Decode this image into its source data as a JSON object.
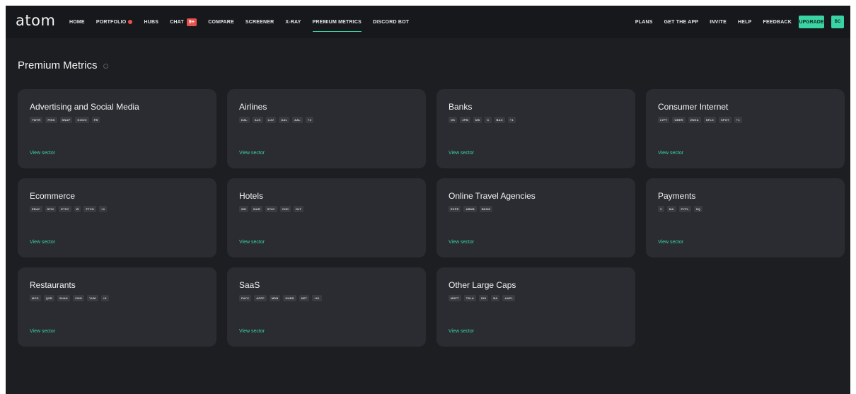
{
  "logo": "atom",
  "nav": {
    "left": [
      {
        "label": "HOME"
      },
      {
        "label": "PORTFOLIO",
        "dot": true
      },
      {
        "label": "HUBS"
      },
      {
        "label": "CHAT",
        "badge": "9+"
      },
      {
        "label": "COMPARE"
      },
      {
        "label": "SCREENER"
      },
      {
        "label": "X-RAY"
      },
      {
        "label": "PREMIUM METRICS",
        "active": true
      },
      {
        "label": "DISCORD BOT"
      }
    ],
    "right": [
      {
        "label": "PLANS"
      },
      {
        "label": "GET THE APP"
      },
      {
        "label": "INVITE"
      },
      {
        "label": "HELP"
      },
      {
        "label": "FEEDBACK"
      }
    ],
    "upgrade": "UPGRADE",
    "avatar": "BC"
  },
  "page_title": "Premium Metrics",
  "view_label": "View sector",
  "sectors": [
    {
      "name": "Advertising and Social Media",
      "tickers": [
        "TWTR",
        "PINS",
        "SNAP",
        "GOOG",
        "FB"
      ]
    },
    {
      "name": "Airlines",
      "tickers": [
        "DAL",
        "ALK",
        "LUV",
        "UAL",
        "AAL",
        "+3"
      ]
    },
    {
      "name": "Banks",
      "tickers": [
        "GS",
        "JPM",
        "MS",
        "C",
        "BAC",
        "+1"
      ]
    },
    {
      "name": "Consumer Internet",
      "tickers": [
        "LYFT",
        "UBER",
        "ZNGA",
        "NFLX",
        "SPOT",
        "+1"
      ]
    },
    {
      "name": "Ecommerce",
      "tickers": [
        "EBAY",
        "SFIX",
        "ETSY",
        "W",
        "FTCH",
        "+4"
      ]
    },
    {
      "name": "Hotels",
      "tickers": [
        "WH",
        "MAR",
        "STAY",
        "CHH",
        "HLT"
      ]
    },
    {
      "name": "Online Travel Agencies",
      "tickers": [
        "EXPE",
        "ABNB",
        "BKNG"
      ]
    },
    {
      "name": "Payments",
      "tickers": [
        "V",
        "MA",
        "PYPL",
        "SQ"
      ]
    },
    {
      "name": "Restaurants",
      "tickers": [
        "MCD",
        "QSR",
        "SHAK",
        "CMG",
        "YUM",
        "+5"
      ]
    },
    {
      "name": "SaaS",
      "tickers": [
        "PAYC",
        "APPF",
        "MDB",
        "HUBS",
        "NET",
        "+61"
      ]
    },
    {
      "name": "Other Large Caps",
      "tickers": [
        "MSFT",
        "TSLA",
        "DIS",
        "BA",
        "AAPL"
      ]
    }
  ]
}
